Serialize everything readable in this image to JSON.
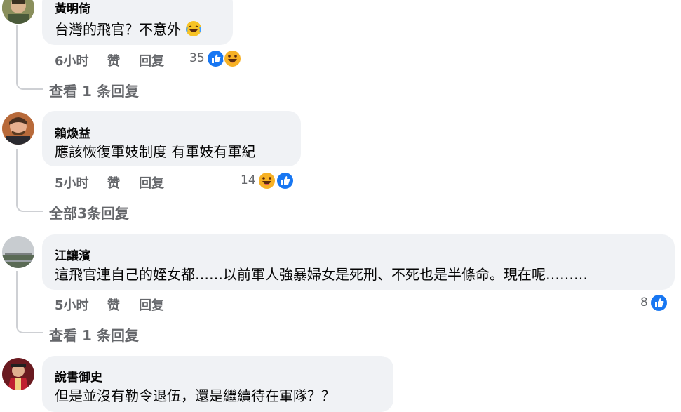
{
  "comments": [
    {
      "author": "黃明倚",
      "text": "台灣的飛官？不意外",
      "time": "6小时",
      "like_label": "赞",
      "reply_label": "回复",
      "reaction_count": "35",
      "reactions": [
        "like-icon",
        "laugh-icon"
      ],
      "view_replies": "查看 1 条回复",
      "trailing_emoji": "laughing-tears-emoji"
    },
    {
      "author": "賴煥益",
      "text": "應該恢復軍妓制度 有軍妓有軍紀",
      "time": "5小时",
      "like_label": "赞",
      "reply_label": "回复",
      "reaction_count": "14",
      "reactions": [
        "laugh-icon",
        "like-icon"
      ],
      "view_replies": "全部3条回复"
    },
    {
      "author": "江讓濱",
      "text": "這飛官連自己的姪女都……以前軍人強暴婦女是死刑、不死也是半條命。現在呢………",
      "time": "5小时",
      "like_label": "赞",
      "reply_label": "回复",
      "reaction_count": "8",
      "reactions": [
        "like-icon"
      ],
      "view_replies": "查看 1 条回复"
    },
    {
      "author": "說書御史",
      "text": "但是並沒有勒令退伍，還是繼續待在軍隊？？"
    }
  ],
  "colors": {
    "bubble": "#f0f2f5",
    "meta": "#65676b",
    "like": "#1877f2",
    "laugh": "#f7b125"
  }
}
